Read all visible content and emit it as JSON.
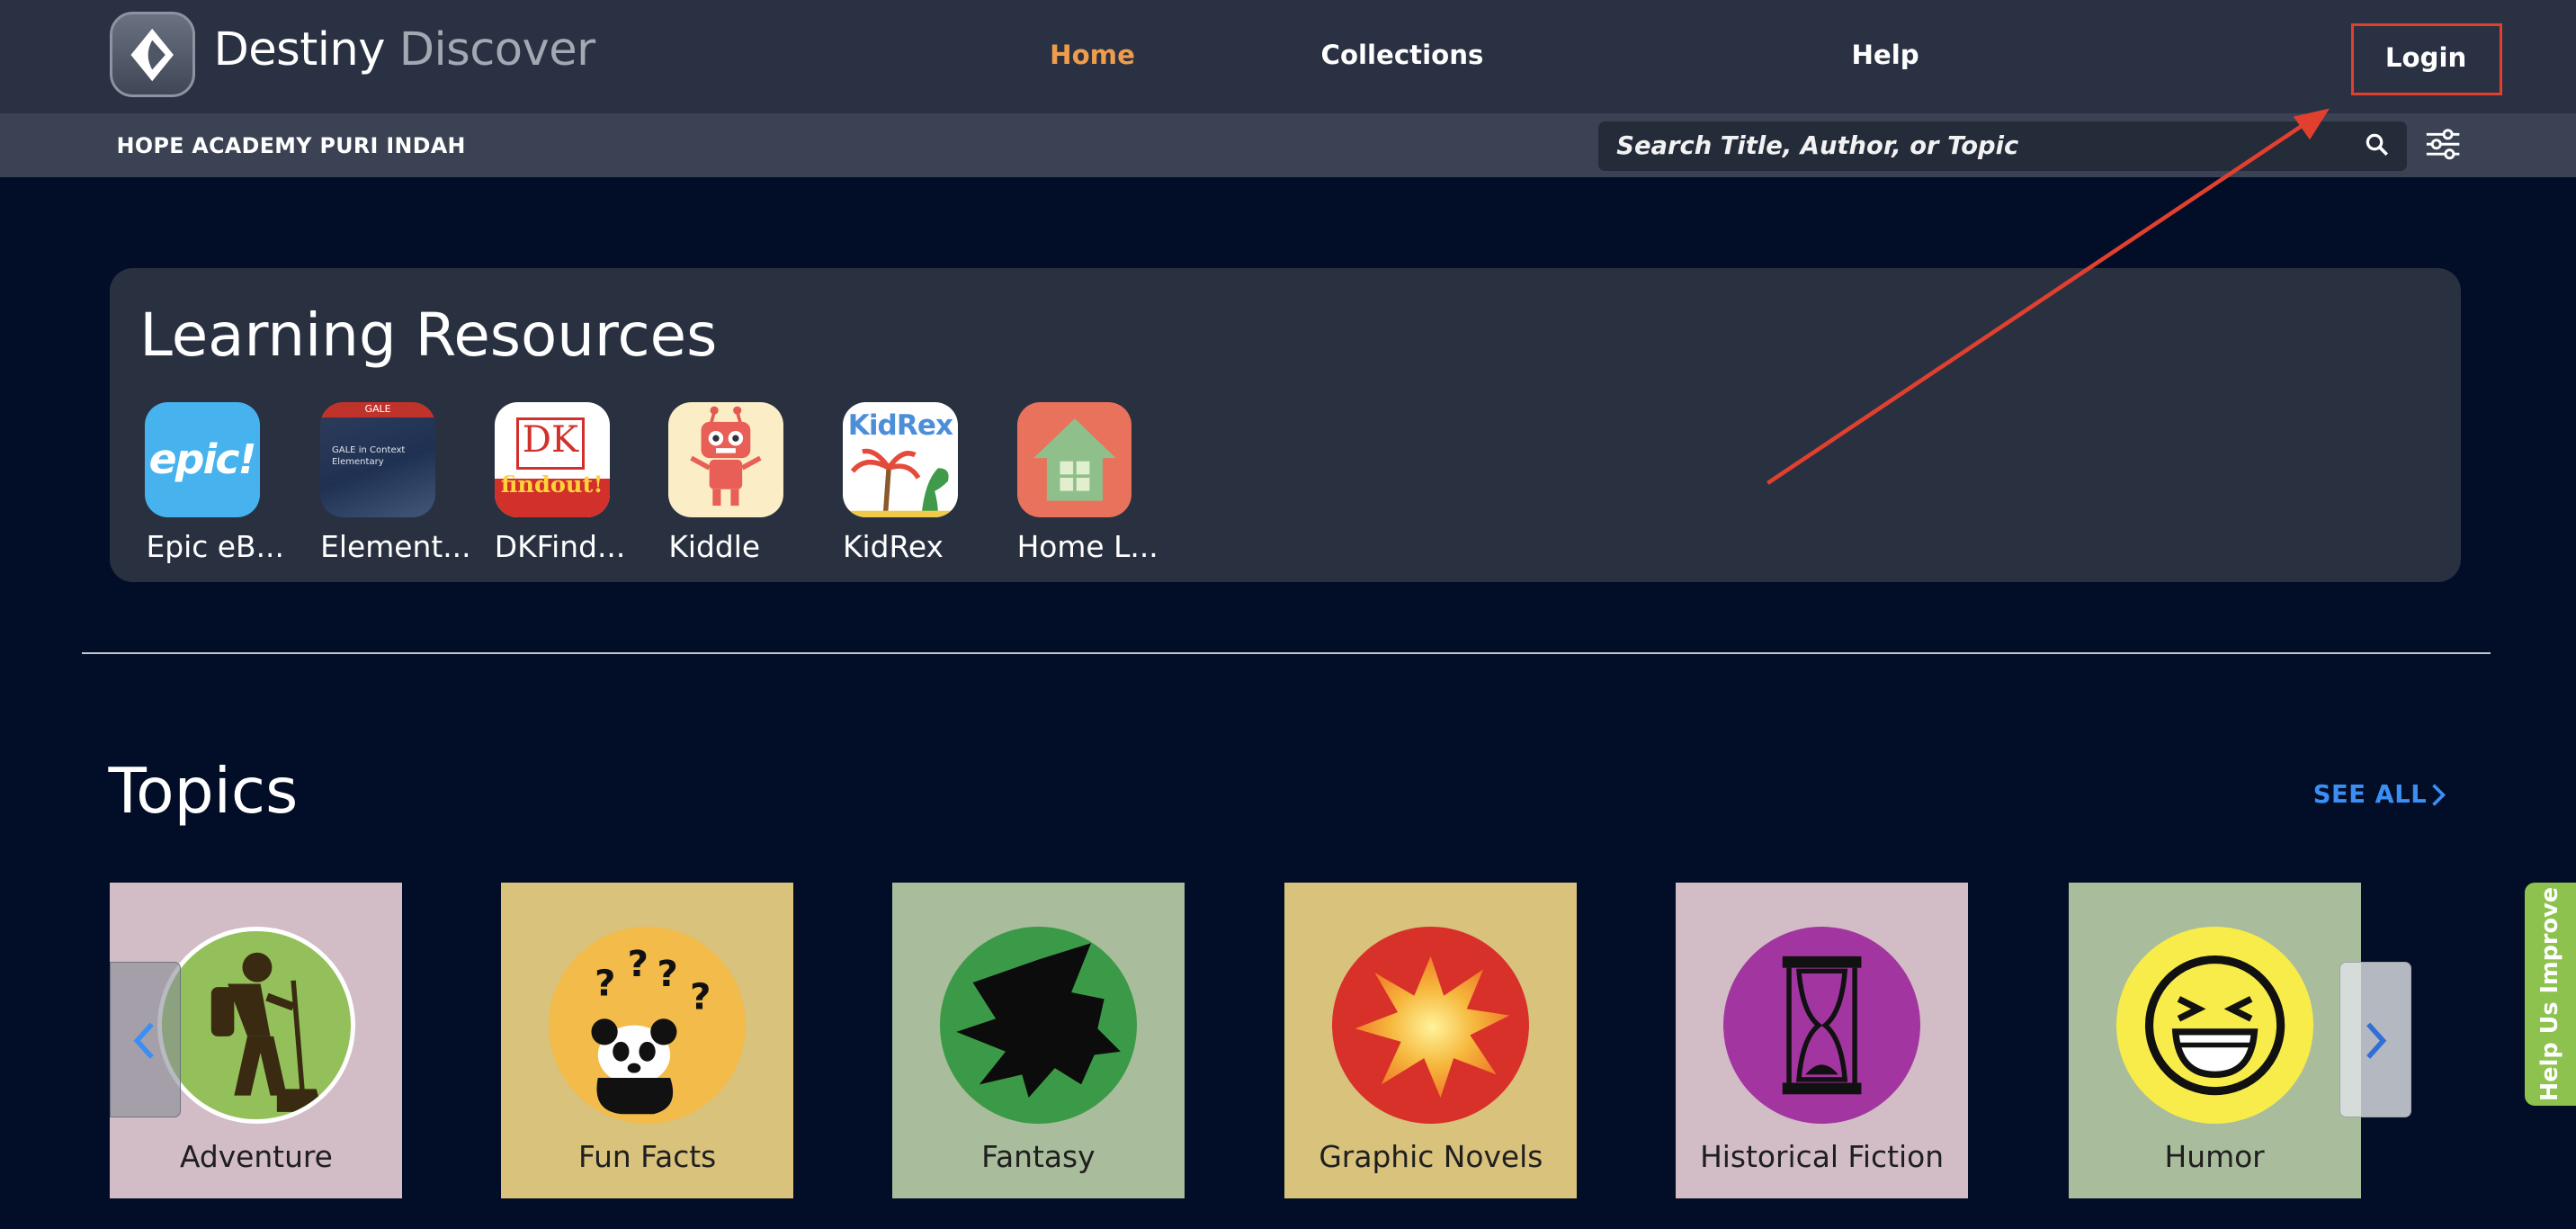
{
  "header": {
    "brand_primary": "Destiny",
    "brand_secondary": "Discover",
    "nav": {
      "home": "Home",
      "collections": "Collections",
      "help": "Help"
    },
    "login": "Login",
    "active_color": "#ef9d4d"
  },
  "subheader": {
    "school": "HOPE ACADEMY PURI INDAH",
    "search_placeholder": "Search Title, Author, or Topic"
  },
  "learning_resources": {
    "title": "Learning Resources",
    "apps": [
      {
        "label": "Epic eB...",
        "icon": "epic-icon",
        "logo_text": "epic!"
      },
      {
        "label": "Element...",
        "icon": "gale-elementary-icon",
        "logo_text": "GALE in Context Elementary",
        "badge": "GALE"
      },
      {
        "label": "DKFind...",
        "icon": "dk-findout-icon",
        "logo_text": "DK",
        "logo_sub": "findout!"
      },
      {
        "label": "Kiddle",
        "icon": "robot-icon"
      },
      {
        "label": "KidRex",
        "icon": "kidrex-icon",
        "logo_text": "KidRex"
      },
      {
        "label": "Home L...",
        "icon": "home-icon"
      }
    ]
  },
  "topics": {
    "title": "Topics",
    "see_all": "SEE ALL",
    "items": [
      {
        "label": "Adventure",
        "icon": "hiker-icon",
        "bg": "#d2bcc6",
        "circle": "#93c05a"
      },
      {
        "label": "Fun Facts",
        "icon": "panda-question-icon",
        "bg": "#d8c27c",
        "circle": "#f2bb4a"
      },
      {
        "label": "Fantasy",
        "icon": "dragon-icon",
        "bg": "#a9bc9c",
        "circle": "#3b9a48"
      },
      {
        "label": "Graphic Novels",
        "icon": "explosion-icon",
        "bg": "#d8c27c",
        "circle": "#d8312a"
      },
      {
        "label": "Historical Fiction",
        "icon": "hourglass-icon",
        "bg": "#d2bcc6",
        "circle": "#a335a1"
      },
      {
        "label": "Humor",
        "icon": "laughing-face-icon",
        "bg": "#a9bc9c",
        "circle": "#f7ec4a"
      }
    ]
  },
  "feedback": {
    "label": "Help Us Improve"
  },
  "annotation": {
    "color": "#e2402f"
  }
}
